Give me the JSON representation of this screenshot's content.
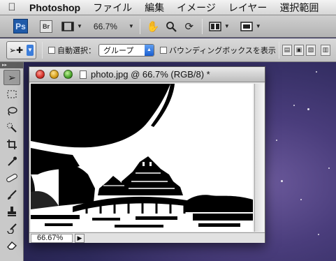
{
  "menubar": {
    "apple_icon": "apple-icon",
    "app_name": "Photoshop",
    "menus": [
      "ファイル",
      "編集",
      "イメージ",
      "レイヤー",
      "選択範囲"
    ]
  },
  "appbar": {
    "ps_logo": "Ps",
    "bridge_logo": "Br",
    "zoom": "66.7%"
  },
  "options": {
    "auto_select_label": "自動選択：",
    "auto_select_value": "グループ",
    "bounding_box_label": "バウンディングボックスを表示"
  },
  "document": {
    "title": "photo.jpg @ 66.7% (RGB/8) *",
    "zoom": "66.67%"
  },
  "colors": {
    "ps_blue": "#1f5aa8",
    "close": "#d2302a",
    "minimize": "#d59d17",
    "zoom": "#4aa52c"
  }
}
